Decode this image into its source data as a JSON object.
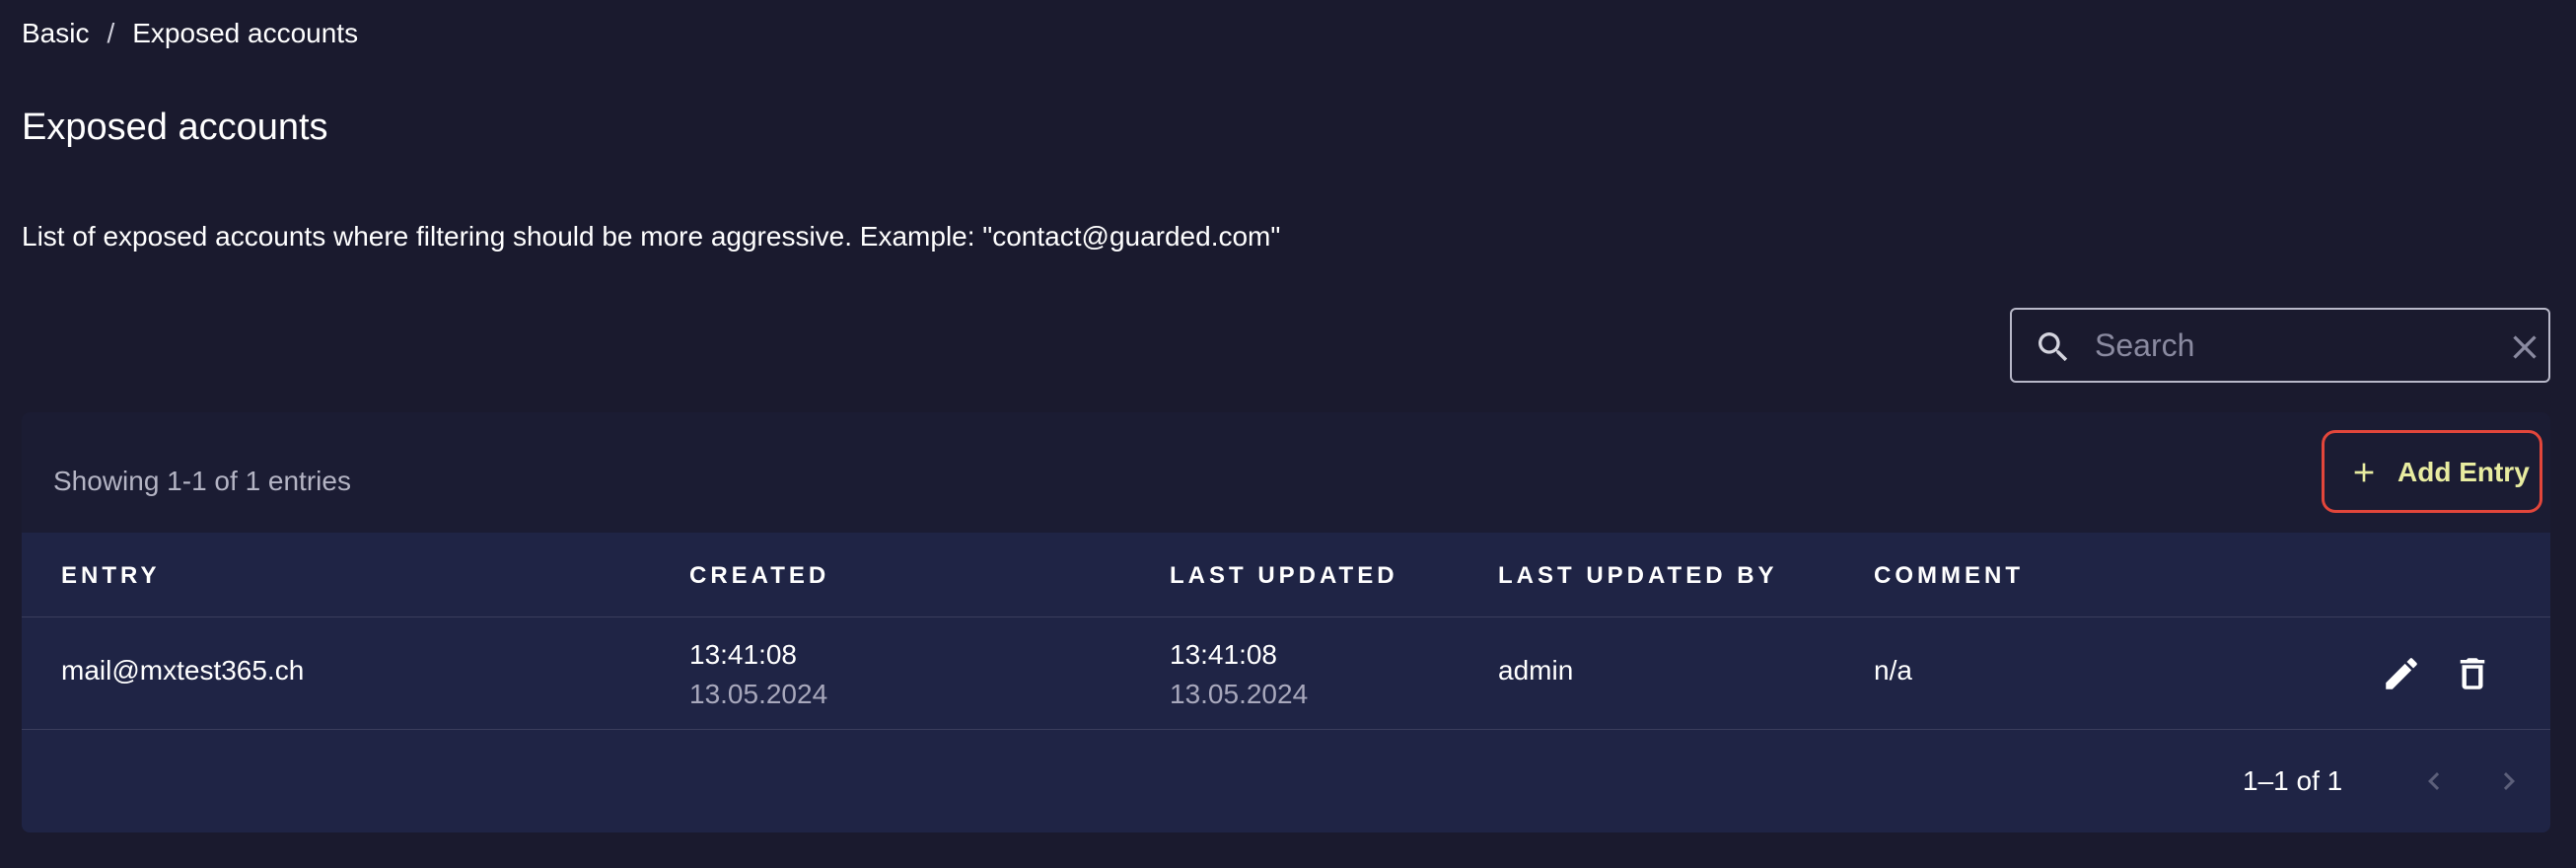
{
  "breadcrumb": {
    "items": [
      "Basic",
      "Exposed accounts"
    ],
    "separator": "/"
  },
  "page": {
    "title": "Exposed accounts",
    "description": "List of exposed accounts where filtering should be more aggressive. Example: \"contact@guarded.com\""
  },
  "search": {
    "placeholder": "Search",
    "value": ""
  },
  "toolbar": {
    "showing": "Showing 1-1 of 1 entries",
    "add_label": "Add Entry"
  },
  "table": {
    "columns": [
      "ENTRY",
      "CREATED",
      "LAST UPDATED",
      "LAST UPDATED BY",
      "COMMENT"
    ],
    "rows": [
      {
        "entry": "mail@mxtest365.ch",
        "created_time": "13:41:08",
        "created_date": "13.05.2024",
        "updated_time": "13:41:08",
        "updated_date": "13.05.2024",
        "updated_by": "admin",
        "comment": "n/a"
      }
    ]
  },
  "pagination": {
    "range": "1–1 of 1"
  },
  "icons": {
    "search": "search-icon",
    "clear": "close-icon",
    "add": "plus-icon",
    "edit": "pencil-icon",
    "delete": "trash-icon",
    "prev": "chevron-left-icon",
    "next": "chevron-right-icon"
  },
  "colors": {
    "background": "#1a1a2e",
    "card": "#1b1c33",
    "table": "#1f2445",
    "accent_border": "#e2463b",
    "accent_text": "#e8eca0"
  }
}
